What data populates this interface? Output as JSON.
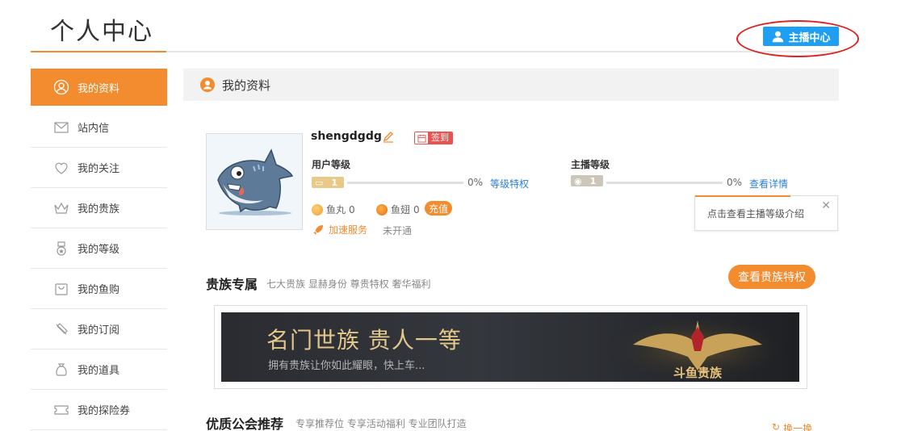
{
  "header": {
    "title": "个人中心",
    "anchor_center_label": "主播中心"
  },
  "sidebar": {
    "items": [
      {
        "label": "我的资料",
        "icon": "user-circle-icon",
        "active": true
      },
      {
        "label": "站内信",
        "icon": "mail-icon",
        "active": false
      },
      {
        "label": "我的关注",
        "icon": "heart-icon",
        "active": false
      },
      {
        "label": "我的贵族",
        "icon": "crown-icon",
        "active": false
      },
      {
        "label": "我的等级",
        "icon": "medal-icon",
        "active": false
      },
      {
        "label": "我的鱼购",
        "icon": "shopping-bag-icon",
        "active": false
      },
      {
        "label": "我的订阅",
        "icon": "subscribe-icon",
        "active": false
      },
      {
        "label": "我的道具",
        "icon": "prop-bag-icon",
        "active": false
      },
      {
        "label": "我的探险券",
        "icon": "ticket-icon",
        "active": false
      }
    ]
  },
  "profile": {
    "section_title": "我的资料",
    "username": "shengdgdg",
    "sign_label": "签到",
    "user_level": {
      "label": "用户等级",
      "level": "1",
      "progress": "0%",
      "link": "等级特权"
    },
    "anchor_level": {
      "label": "主播等级",
      "level": "1",
      "progress": "0%",
      "link": "查看详情"
    },
    "fish_ball": {
      "label": "鱼丸",
      "value": "0"
    },
    "fish_fin": {
      "label": "鱼翅",
      "value": "0"
    },
    "recharge_label": "充值",
    "accel": {
      "label": "加速服务",
      "status": "未开通"
    },
    "tooltip": "点击查看主播等级介绍"
  },
  "noble": {
    "title": "贵族专属",
    "subtitle": "七大贵族 显赫身份 尊贵特权 奢华福利",
    "button": "查看贵族特权",
    "banner_title": "名门世族 贵人一等",
    "banner_sub": "拥有贵族让你如此耀眼，快上车...",
    "banner_logo_text": "斗鱼贵族"
  },
  "guild": {
    "title": "优质公会推荐",
    "subtitle": "专享推荐位 专享活动福利 专业团队打造",
    "refresh": "换一换"
  },
  "colors": {
    "accent": "#f38b2f",
    "blue": "#1e9ff2",
    "link": "#2b7fd6",
    "annotation_red": "#e0201e"
  }
}
